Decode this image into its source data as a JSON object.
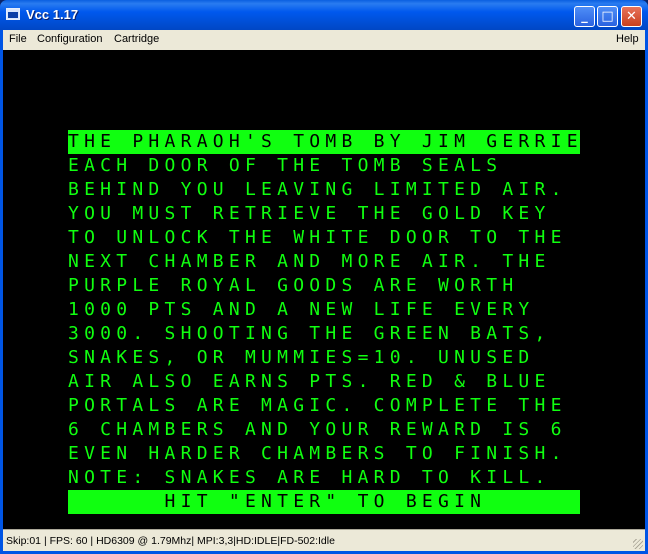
{
  "window": {
    "title": "Vcc 1.17",
    "minimize_glyph": "_",
    "maximize_glyph": "□",
    "close_glyph": "✕"
  },
  "menu": {
    "file": "File",
    "configuration": "Configuration",
    "cartridge": "Cartridge",
    "help": "Help"
  },
  "screen": {
    "lines": [
      "THE PHARAOH'S TOMB BY JIM GERRIE",
      "EACH DOOR OF THE TOMB SEALS",
      "BEHIND YOU LEAVING LIMITED AIR.",
      "YOU MUST RETRIEVE THE GOLD KEY",
      "TO UNLOCK THE WHITE DOOR TO THE",
      "NEXT CHAMBER AND MORE AIR. THE",
      "PURPLE ROYAL GOODS ARE WORTH",
      "1000 PTS AND A NEW LIFE EVERY",
      "3000. SHOOTING THE GREEN BATS,",
      "SNAKES, OR MUMMIES=10. UNUSED",
      "AIR ALSO EARNS PTS. RED & BLUE",
      "PORTALS ARE MAGIC. COMPLETE THE",
      "6 CHAMBERS AND YOUR REWARD IS 6",
      "EVEN HARDER CHAMBERS TO FINISH.",
      "NOTE: SNAKES ARE HARD TO KILL.",
      "      HIT \"ENTER\" TO BEGIN"
    ],
    "text_color": "#10ff10",
    "background_color": "#000000"
  },
  "status": {
    "text": "Skip:01 | FPS: 60 | HD6309 @ 1.79Mhz| MPI:3,3|HD:IDLE|FD-502:Idle"
  }
}
